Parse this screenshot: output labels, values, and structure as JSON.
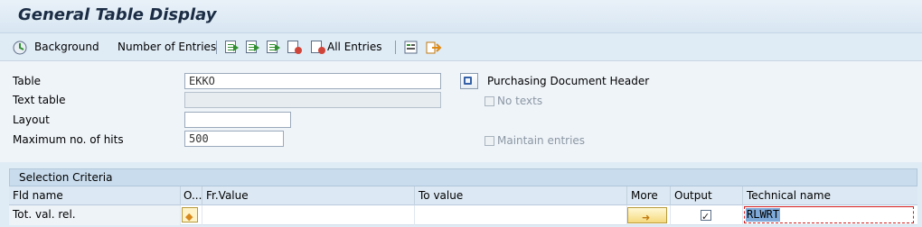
{
  "window": {
    "title": "General Table Display"
  },
  "toolbar": {
    "background_label": "Background",
    "number_of_entries_label": "Number of Entries",
    "all_entries_label": "All Entries"
  },
  "form": {
    "table_label": "Table",
    "table_value": "EKKO",
    "table_description": "Purchasing Document Header",
    "text_table_label": "Text table",
    "text_table_value": "",
    "no_texts_label": "No texts",
    "layout_label": "Layout",
    "layout_value": "",
    "max_hits_label": "Maximum no. of hits",
    "max_hits_value": "500",
    "maintain_entries_label": "Maintain entries"
  },
  "selection": {
    "header": "Selection Criteria",
    "columns": [
      "Fld name",
      "O...",
      "Fr.Value",
      "To value",
      "More",
      "Output",
      "Technical name"
    ],
    "rows": [
      {
        "field_name": "Tot. val. rel.",
        "from": "",
        "to": "",
        "output": true,
        "technical_name": "RLWRT"
      }
    ]
  }
}
